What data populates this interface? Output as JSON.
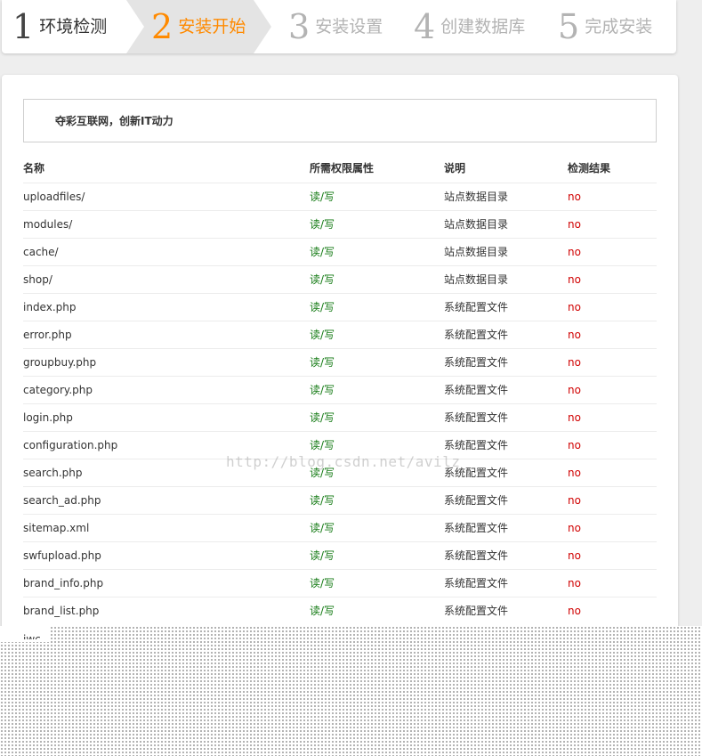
{
  "steps": [
    {
      "num": "1",
      "label": "环境检测",
      "state": "done"
    },
    {
      "num": "2",
      "label": "安装开始",
      "state": "active"
    },
    {
      "num": "3",
      "label": "安装设置",
      "state": "future"
    },
    {
      "num": "4",
      "label": "创建数据库",
      "state": "future"
    },
    {
      "num": "5",
      "label": "完成安装",
      "state": "future"
    }
  ],
  "notice": "夺彩互联网，创新IT动力",
  "table": {
    "headers": [
      "名称",
      "所需权限属性",
      "说明",
      "检测结果"
    ],
    "rows": [
      {
        "name": "uploadfiles/",
        "perm": "读/写",
        "desc": "站点数据目录",
        "result": "no"
      },
      {
        "name": "modules/",
        "perm": "读/写",
        "desc": "站点数据目录",
        "result": "no"
      },
      {
        "name": "cache/",
        "perm": "读/写",
        "desc": "站点数据目录",
        "result": "no"
      },
      {
        "name": "shop/",
        "perm": "读/写",
        "desc": "站点数据目录",
        "result": "no"
      },
      {
        "name": "index.php",
        "perm": "读/写",
        "desc": "系统配置文件",
        "result": "no"
      },
      {
        "name": "error.php",
        "perm": "读/写",
        "desc": "系统配置文件",
        "result": "no"
      },
      {
        "name": "groupbuy.php",
        "perm": "读/写",
        "desc": "系统配置文件",
        "result": "no"
      },
      {
        "name": "category.php",
        "perm": "读/写",
        "desc": "系统配置文件",
        "result": "no"
      },
      {
        "name": "login.php",
        "perm": "读/写",
        "desc": "系统配置文件",
        "result": "no"
      },
      {
        "name": "configuration.php",
        "perm": "读/写",
        "desc": "系统配置文件",
        "result": "no"
      },
      {
        "name": "search.php",
        "perm": "读/写",
        "desc": "系统配置文件",
        "result": "no"
      },
      {
        "name": "search_ad.php",
        "perm": "读/写",
        "desc": "系统配置文件",
        "result": "no"
      },
      {
        "name": "sitemap.xml",
        "perm": "读/写",
        "desc": "系统配置文件",
        "result": "no"
      },
      {
        "name": "swfupload.php",
        "perm": "读/写",
        "desc": "系统配置文件",
        "result": "no"
      },
      {
        "name": "brand_info.php",
        "perm": "读/写",
        "desc": "系统配置文件",
        "result": "no"
      },
      {
        "name": "brand_list.php",
        "perm": "读/写",
        "desc": "系统配置文件",
        "result": "no"
      }
    ],
    "partial_row": "jwc"
  },
  "watermark": "http://blog.csdn.net/avilz",
  "colors": {
    "active": "#ff8a00",
    "ok": "#137a13",
    "fail": "#d00000",
    "future": "#b3b3b3"
  }
}
